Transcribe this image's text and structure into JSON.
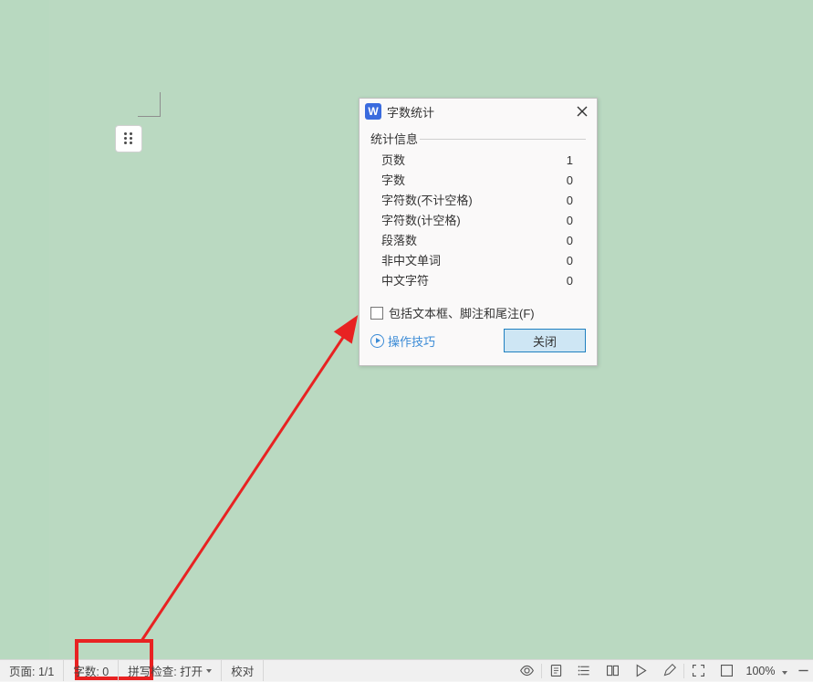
{
  "dialog": {
    "title": "字数统计",
    "section_label": "统计信息",
    "stats": [
      {
        "label": "页数",
        "value": "1"
      },
      {
        "label": "字数",
        "value": "0"
      },
      {
        "label": "字符数(不计空格)",
        "value": "0"
      },
      {
        "label": "字符数(计空格)",
        "value": "0"
      },
      {
        "label": "段落数",
        "value": "0"
      },
      {
        "label": "非中文单词",
        "value": "0"
      },
      {
        "label": "中文字符",
        "value": "0"
      }
    ],
    "checkbox_label": "包括文本框、脚注和尾注(F)",
    "tip_link": "操作技巧",
    "close_button": "关闭"
  },
  "statusbar": {
    "page": "页面: 1/1",
    "words": "字数: 0",
    "spellcheck": "拼写检查: 打开",
    "proof": "校对",
    "zoom": "100%"
  }
}
